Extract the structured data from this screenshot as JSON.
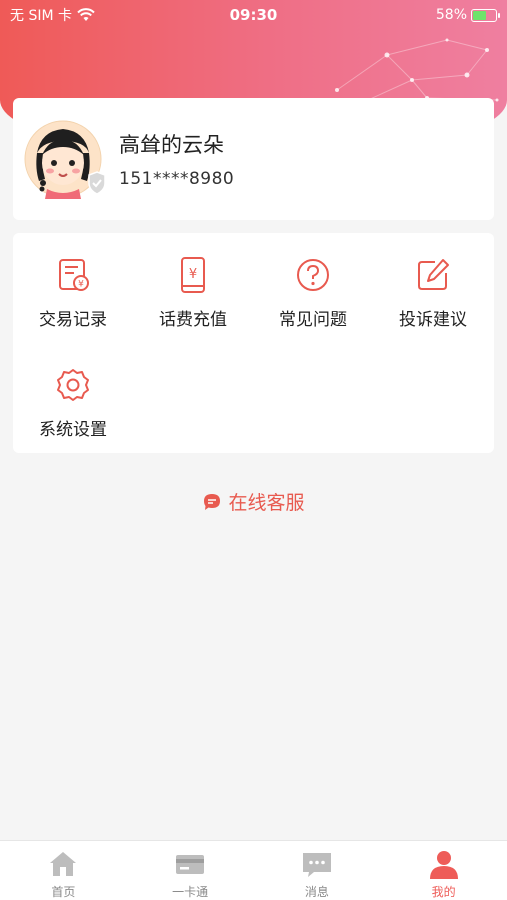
{
  "status_bar": {
    "carrier": "无 SIM 卡",
    "time": "09:30",
    "battery": "58%",
    "battery_level": 0.58
  },
  "profile": {
    "username": "高耸的云朵",
    "phone": "151****8980"
  },
  "menu": {
    "items": [
      {
        "label": "交易记录",
        "icon": "receipt-icon"
      },
      {
        "label": "话费充值",
        "icon": "phone-recharge-icon"
      },
      {
        "label": "常见问题",
        "icon": "question-icon"
      },
      {
        "label": "投诉建议",
        "icon": "edit-icon"
      },
      {
        "label": "系统设置",
        "icon": "gear-icon"
      }
    ]
  },
  "service": {
    "label": "在线客服",
    "icon": "chat-bubble-icon"
  },
  "tabs": [
    {
      "label": "首页",
      "icon": "home-icon"
    },
    {
      "label": "一卡通",
      "icon": "card-icon"
    },
    {
      "label": "消息",
      "icon": "message-icon"
    },
    {
      "label": "我的",
      "icon": "person-icon"
    }
  ],
  "active_tab": 3,
  "colors": {
    "accent": "#ee5c58",
    "header_gradient_start": "#ef5a57",
    "header_gradient_end": "#ef7fa0",
    "tab_inactive": "#bdbdbd"
  }
}
